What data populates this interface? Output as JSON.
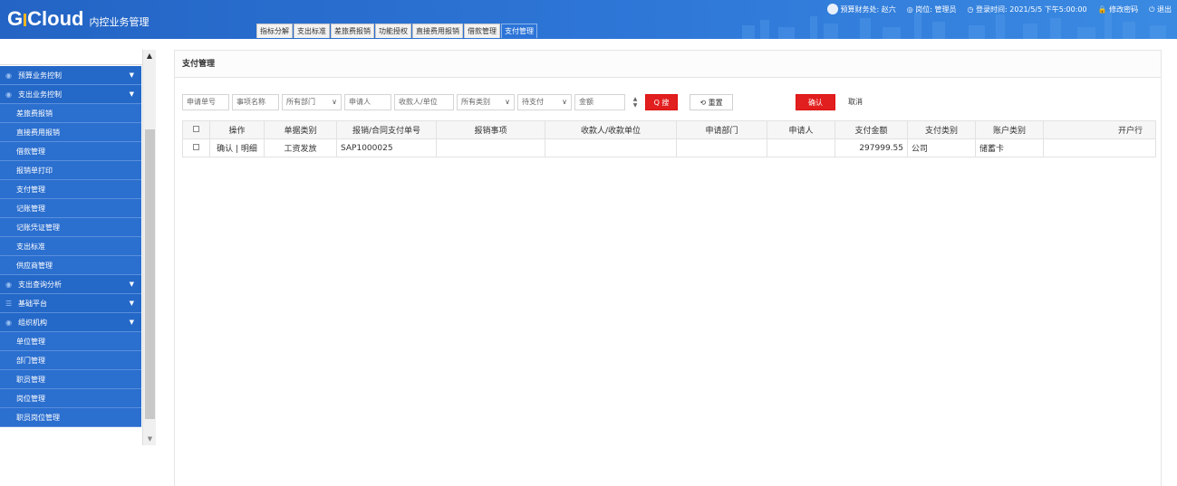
{
  "header": {
    "logo_g": "G",
    "logo_cloud": "Cloud",
    "logo_sub": "内控业务管理",
    "tabs": [
      {
        "label": "指标分解"
      },
      {
        "label": "支出标准"
      },
      {
        "label": "差旅费报销"
      },
      {
        "label": "功能授权"
      },
      {
        "label": "直接费用报销"
      },
      {
        "label": "借款管理"
      },
      {
        "label": "支付管理"
      }
    ],
    "active_tab": "支付管理",
    "user": "预算财务处: 赵六",
    "role": "◎ 岗位: 管理员",
    "login_time": "◷ 登录时间: 2021/5/5 下午5:00:00",
    "change_password": "🔒 修改密码",
    "logout": "⏻ 退出"
  },
  "sidebar": {
    "items": [
      {
        "label": "预算业务控制",
        "type": "group",
        "icon": "◉"
      },
      {
        "label": "支出业务控制",
        "type": "group",
        "icon": "◉"
      },
      {
        "label": "差旅费报销",
        "type": "item"
      },
      {
        "label": "直接费用报销",
        "type": "item"
      },
      {
        "label": "借款管理",
        "type": "item"
      },
      {
        "label": "报销单打印",
        "type": "item"
      },
      {
        "label": "支付管理",
        "type": "item"
      },
      {
        "label": "记账管理",
        "type": "item"
      },
      {
        "label": "记账凭证管理",
        "type": "item"
      },
      {
        "label": "支出标准",
        "type": "item"
      },
      {
        "label": "供应商管理",
        "type": "item"
      },
      {
        "label": "支出查询分析",
        "type": "group",
        "icon": "◉"
      },
      {
        "label": "基础平台",
        "type": "group",
        "icon": "☰"
      },
      {
        "label": "组织机构",
        "type": "group",
        "icon": "◉"
      },
      {
        "label": "单位管理",
        "type": "item"
      },
      {
        "label": "部门管理",
        "type": "item"
      },
      {
        "label": "职员管理",
        "type": "item"
      },
      {
        "label": "岗位管理",
        "type": "item"
      },
      {
        "label": "职员岗位管理",
        "type": "item"
      }
    ],
    "arrow": "▼",
    "scroll_up": "▲",
    "scroll_down": "▼"
  },
  "page": {
    "title": "支付管理",
    "filters": {
      "doc_no": "申请单号",
      "item_name": "事项名称",
      "department": "所有部门",
      "applicant": "申请人",
      "payee": "收款人/单位",
      "category": "所有类别",
      "status": "待支付",
      "amount": "金额",
      "dropdown_glyph": "∨"
    },
    "spin_up": "▲",
    "spin_down": "▼",
    "search_label": "Q 搜索",
    "reset_label": "⟲ 重置",
    "confirm_label": "确认",
    "cancel_label": "取消"
  },
  "table": {
    "headers": [
      "",
      "操作",
      "单据类别",
      "报销/合同支付单号",
      "报销事项",
      "收款人/收款单位",
      "申请部门",
      "申请人",
      "支付金额",
      "支付类别",
      "账户类别",
      "开户行"
    ],
    "rows": [
      {
        "op": "确认 | 明细",
        "category": "工资发放",
        "doc_no": "SAP1000025",
        "matter": "",
        "payee": "",
        "dept": "",
        "applicant": "",
        "amount": "297999.55",
        "pay_type": "公司",
        "account_type": "储蓄卡",
        "bank": ""
      }
    ]
  },
  "colors": {
    "header_blue": "#2b6fcf",
    "sidebar_blue": "#2b6fcf",
    "accent_red": "#e21f1f",
    "logo_yellow": "#f4b622"
  }
}
